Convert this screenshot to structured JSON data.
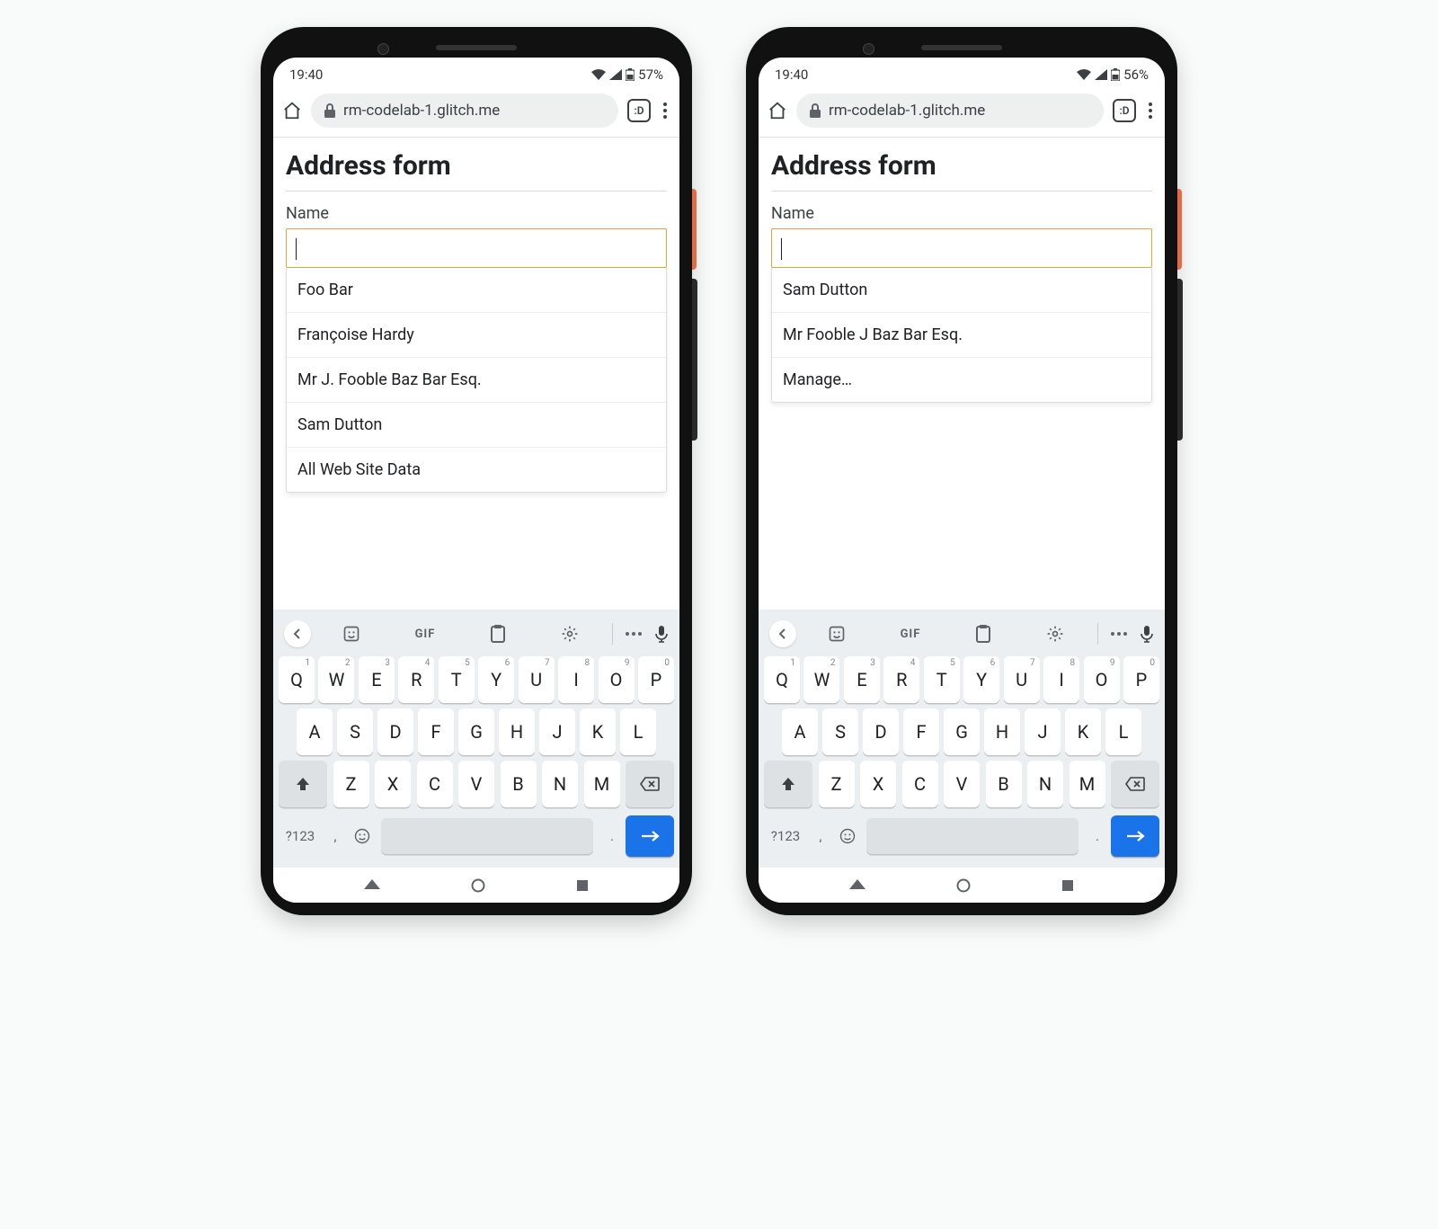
{
  "phones": [
    {
      "status": {
        "time": "19:40",
        "battery": "57%"
      },
      "url": "rm-codelab-1.glitch.me",
      "tab_count": ":D",
      "page": {
        "title": "Address form",
        "field_label": "Name",
        "input_value": "",
        "suggestions": [
          "Foo Bar",
          "Françoise Hardy",
          "Mr J. Fooble Baz Bar Esq.",
          "Sam Dutton",
          "All Web Site Data"
        ]
      }
    },
    {
      "status": {
        "time": "19:40",
        "battery": "56%"
      },
      "url": "rm-codelab-1.glitch.me",
      "tab_count": ":D",
      "page": {
        "title": "Address form",
        "field_label": "Name",
        "input_value": "",
        "suggestions": [
          "Sam Dutton",
          "Mr Fooble J Baz Bar Esq.",
          "Manage…"
        ]
      }
    }
  ],
  "keyboard": {
    "gif_label": "GIF",
    "row1": [
      "Q",
      "W",
      "E",
      "R",
      "T",
      "Y",
      "U",
      "I",
      "O",
      "P"
    ],
    "row1_sup": [
      "1",
      "2",
      "3",
      "4",
      "5",
      "6",
      "7",
      "8",
      "9",
      "0"
    ],
    "row2": [
      "A",
      "S",
      "D",
      "F",
      "G",
      "H",
      "J",
      "K",
      "L"
    ],
    "row3": [
      "Z",
      "X",
      "C",
      "V",
      "B",
      "N",
      "M"
    ],
    "sym_label": "?123",
    "comma": ",",
    "period": "."
  }
}
